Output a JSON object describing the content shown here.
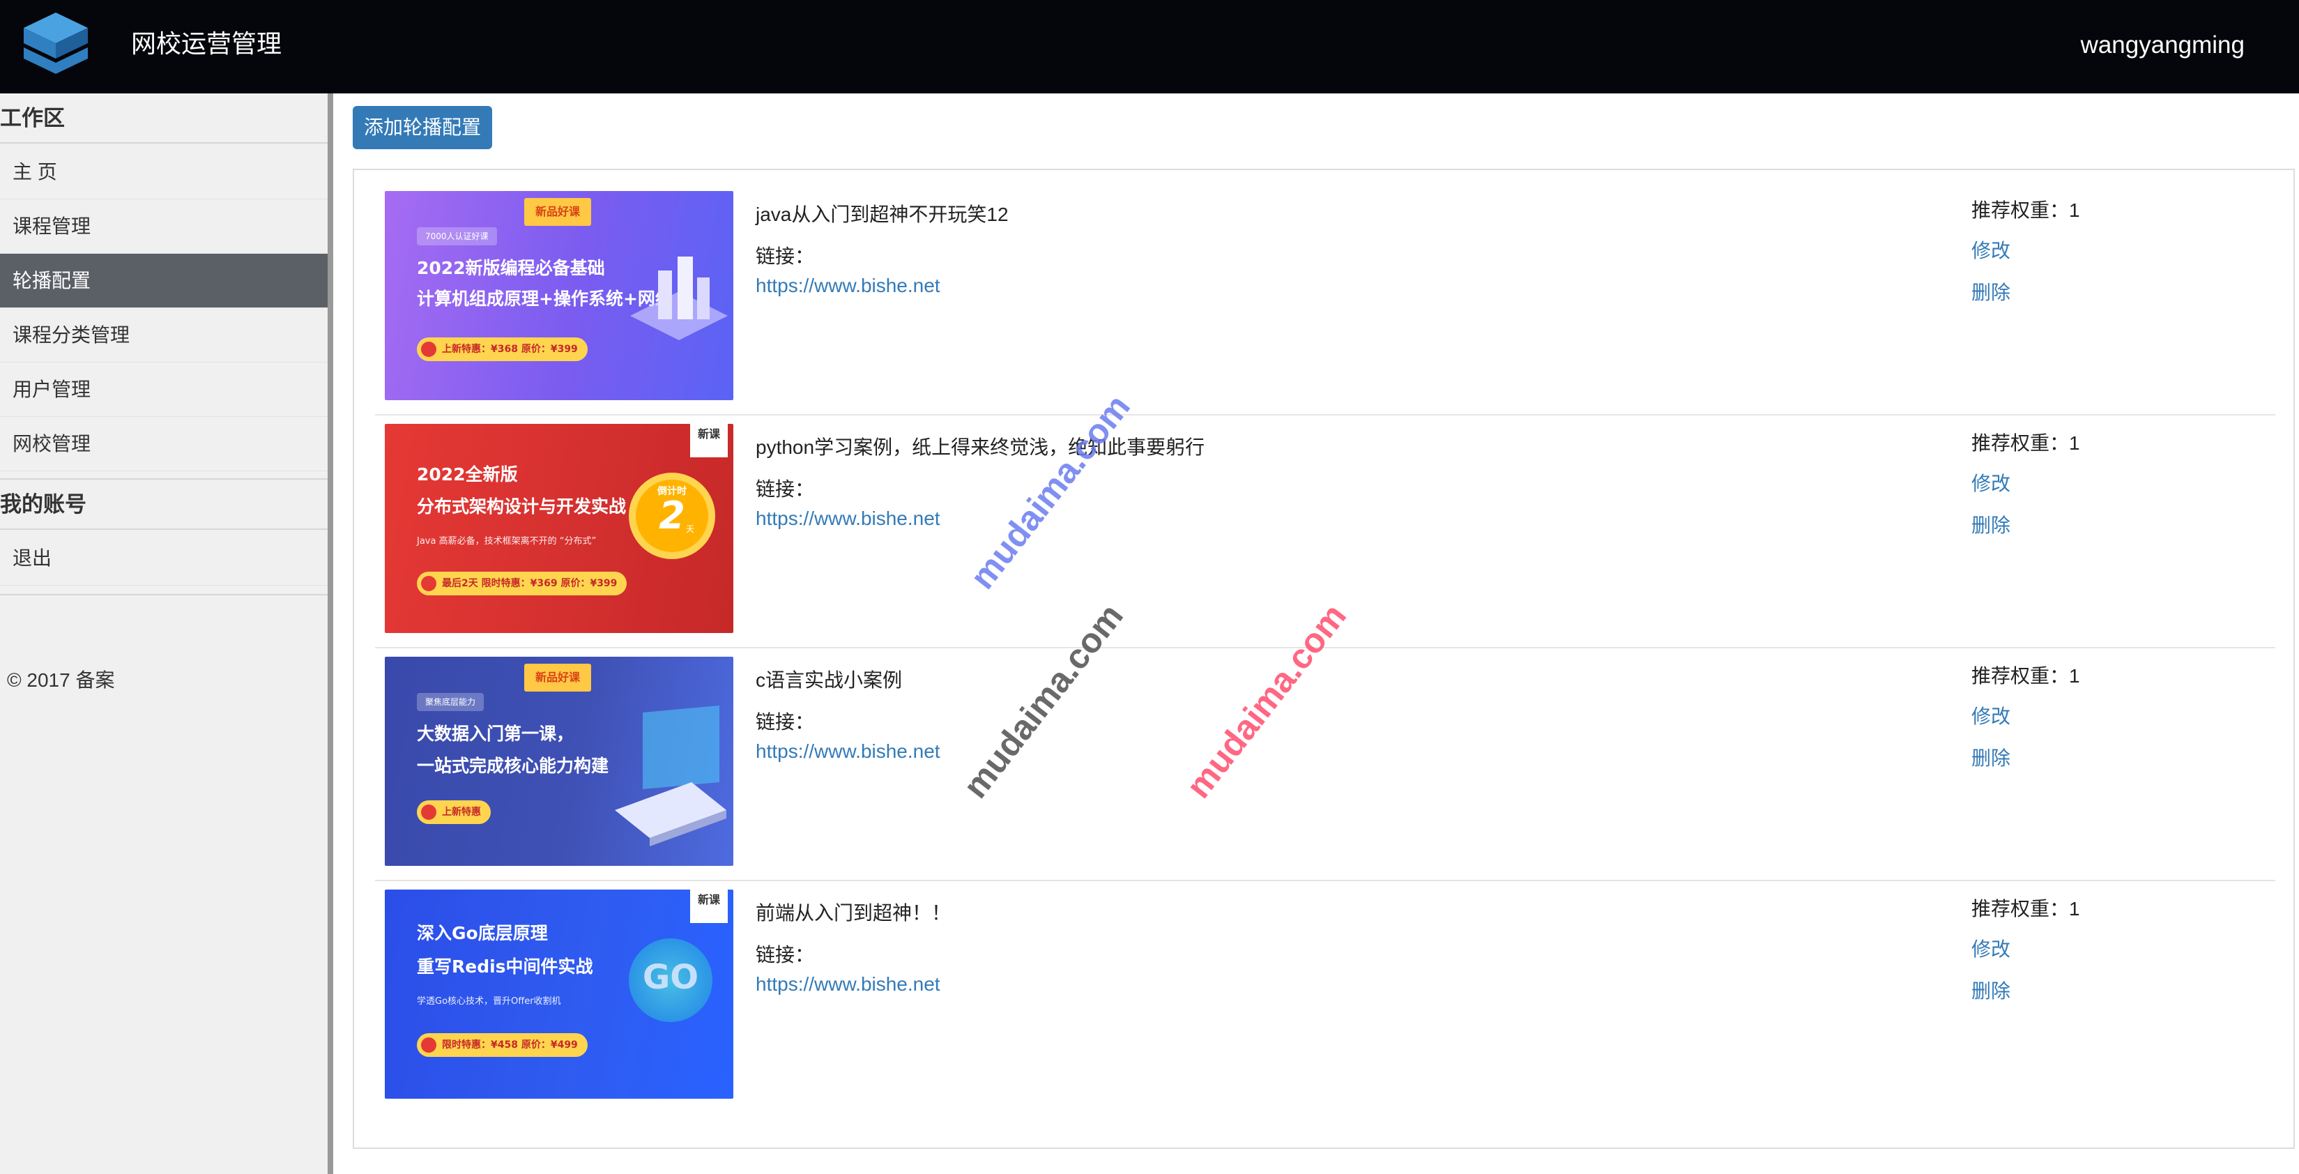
{
  "header": {
    "app_title": "网校运营管理",
    "username": "wangyangming",
    "logo_icon": "stacked-cube-logo"
  },
  "sidebar": {
    "section1_title": "工作区",
    "items": [
      {
        "label": "主 页",
        "active": false
      },
      {
        "label": "课程管理",
        "active": false
      },
      {
        "label": "轮播配置",
        "active": true
      },
      {
        "label": "课程分类管理",
        "active": false
      },
      {
        "label": "用户管理",
        "active": false
      },
      {
        "label": "网校管理",
        "active": false
      }
    ],
    "section2_title": "我的账号",
    "account_items": [
      {
        "label": "退出"
      }
    ],
    "footer": "© 2017  备案"
  },
  "toolbar": {
    "add_label": "添加轮播配置"
  },
  "carousel": {
    "link_label": "链接：",
    "weight_label": "推荐权重：",
    "edit_label": "修改",
    "delete_label": "删除",
    "items": [
      {
        "title": "java从入门到超神不开玩笑12",
        "url": "https://www.bishe.net",
        "weight": "1",
        "banner": {
          "tag": "新品好课",
          "pill": "7000人认证好课",
          "line1": "2022新版编程必备基础",
          "line2": "计算机组成原理+操作系统+网络",
          "chip": "上新特惠：¥368  原价：¥399"
        }
      },
      {
        "title": "python学习案例，纸上得来终觉浅，绝知此事要躬行",
        "url": "https://www.bishe.net",
        "weight": "1",
        "banner": {
          "corner": "新课",
          "line1": "2022全新版",
          "line2": "分布式架构设计与开发实战",
          "small": "Java 高薪必备，技术框架离不开的 “分布式”",
          "countdown_label": "倒计时",
          "countdown_num": "2",
          "countdown_unit": "天",
          "chip": "最后2天 限时特惠：¥369  原价：¥399"
        }
      },
      {
        "title": "c语言实战小案例",
        "url": "https://www.bishe.net",
        "weight": "1",
        "banner": {
          "tag": "新品好课",
          "pill": "聚焦底层能力",
          "line1": "大数据入门第一课，",
          "line2": "一站式完成核心能力构建",
          "chip": "上新特惠"
        }
      },
      {
        "title": "前端从入门到超神！！",
        "url": "https://www.bishe.net",
        "weight": "1",
        "banner": {
          "corner": "新课",
          "line1": "深入Go底层原理",
          "line2": "重写Redis中间件实战",
          "small": "学透Go核心技术，晋升Offer收割机",
          "logo_text": "GO",
          "chip": "限时特惠：¥458  原价：¥499"
        }
      }
    ]
  },
  "watermarks": [
    "mudaima.com",
    "mudaima.com",
    "mudaima.com"
  ],
  "colors": {
    "header_bg": "#05060b",
    "link_blue": "#337ab7",
    "active_nav": "#5b5f66",
    "wm_blue": "#6b7cf0",
    "wm_gray": "#444444",
    "wm_red": "#ff4d6d"
  }
}
